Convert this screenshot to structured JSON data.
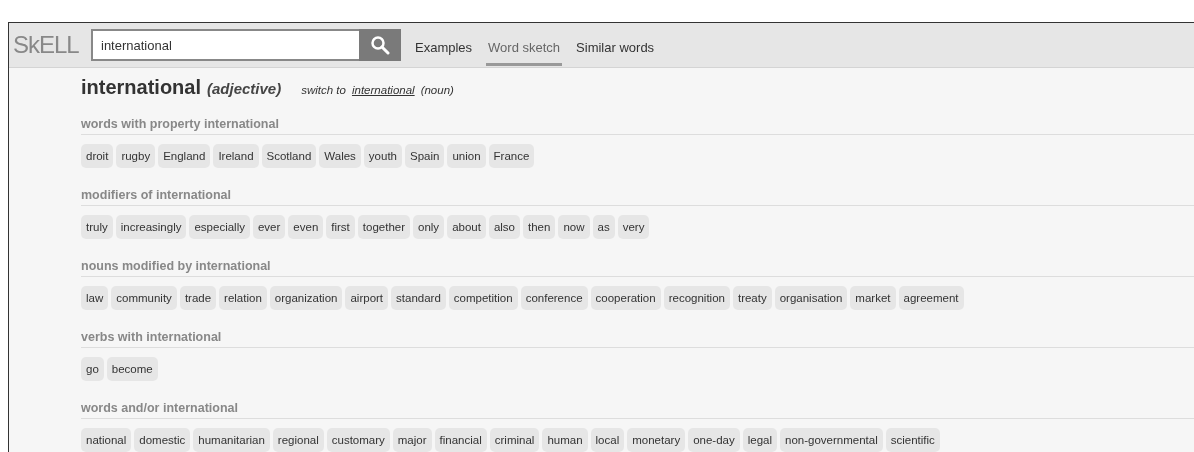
{
  "logo": "SkELL",
  "search": {
    "value": "international"
  },
  "tabs": [
    {
      "label": "Examples",
      "selected": false
    },
    {
      "label": "Word sketch",
      "selected": true
    },
    {
      "label": "Similar words",
      "selected": false
    }
  ],
  "heading": {
    "word": "international",
    "pos": "(adjective)",
    "switch_prefix": "switch to",
    "switch_link": "international",
    "switch_pos": "(noun)"
  },
  "sections": [
    {
      "title": "words with property international",
      "words": [
        "droit",
        "rugby",
        "England",
        "Ireland",
        "Scotland",
        "Wales",
        "youth",
        "Spain",
        "union",
        "France"
      ]
    },
    {
      "title": "modifiers of international",
      "words": [
        "truly",
        "increasingly",
        "especially",
        "ever",
        "even",
        "first",
        "together",
        "only",
        "about",
        "also",
        "then",
        "now",
        "as",
        "very"
      ]
    },
    {
      "title": "nouns modified by international",
      "words": [
        "law",
        "community",
        "trade",
        "relation",
        "organization",
        "airport",
        "standard",
        "competition",
        "conference",
        "cooperation",
        "recognition",
        "treaty",
        "organisation",
        "market",
        "agreement"
      ]
    },
    {
      "title": "verbs with international",
      "words": [
        "go",
        "become"
      ]
    },
    {
      "title": "words and/or international",
      "words": [
        "national",
        "domestic",
        "humanitarian",
        "regional",
        "customary",
        "major",
        "financial",
        "criminal",
        "human",
        "local",
        "monetary",
        "one-day",
        "legal",
        "non-governmental",
        "scientific"
      ]
    }
  ]
}
